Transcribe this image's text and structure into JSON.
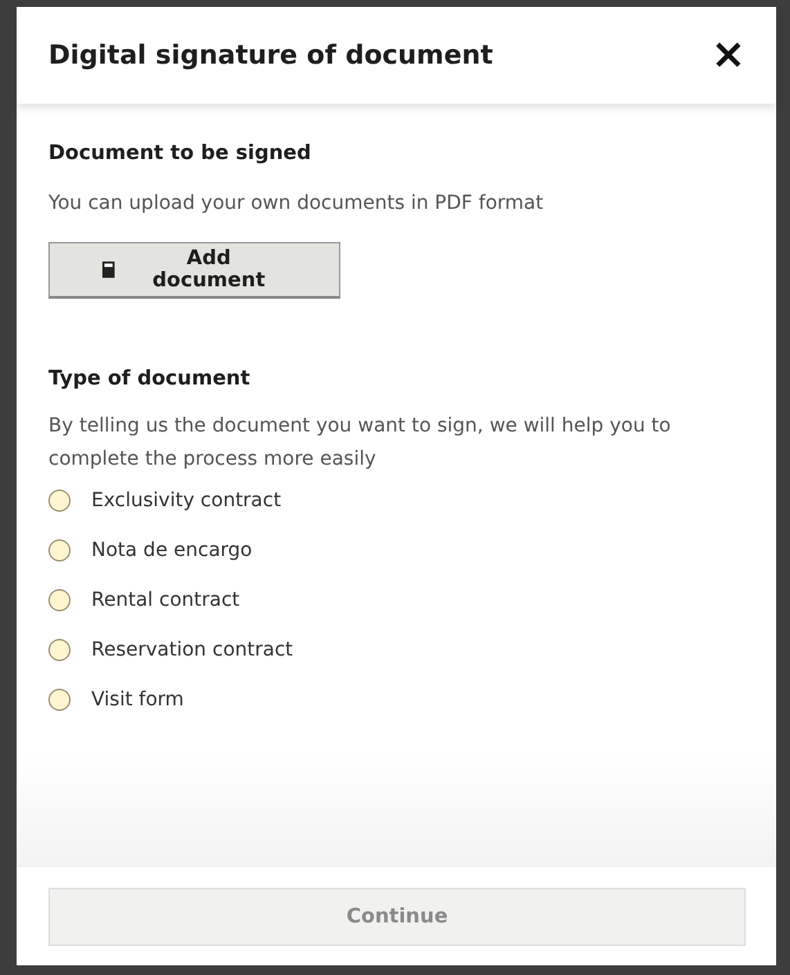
{
  "dialog": {
    "title": "Digital signature of document",
    "close_label": "×"
  },
  "upload_section": {
    "heading": "Document to be signed",
    "description": "You can upload your own documents in PDF format",
    "button": "Add document"
  },
  "type_section": {
    "heading": "Type of document",
    "description": "By telling us the document you want to sign, we will help you to complete the process more easily",
    "options": [
      {
        "label": "Exclusivity contract",
        "selected": false
      },
      {
        "label": "Nota de encargo",
        "selected": false
      },
      {
        "label": "Rental contract",
        "selected": false
      },
      {
        "label": "Reservation contract",
        "selected": false
      },
      {
        "label": "Visit form",
        "selected": false
      }
    ]
  },
  "footer": {
    "button": "Continue",
    "disabled": true
  }
}
